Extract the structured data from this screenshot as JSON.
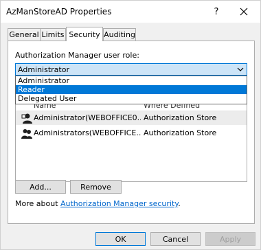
{
  "window": {
    "title": "AzManStoreAD Properties",
    "help_glyph": "?"
  },
  "tabs": [
    {
      "label": "General"
    },
    {
      "label": "Limits"
    },
    {
      "label": "Security",
      "active": true
    },
    {
      "label": "Auditing"
    }
  ],
  "security": {
    "role_label": "Authorization Manager user role:",
    "role_selected": "Administrator",
    "role_options": [
      "Administrator",
      "Reader",
      "Delegated User"
    ],
    "highlighted_option": "Reader",
    "list_columns": {
      "name": "Name",
      "where": "Where Defined"
    },
    "users": [
      {
        "name": "Administrator(WEBOFFICE0...",
        "where": "Authorization Store",
        "icon": "user-icon"
      },
      {
        "name": "Administrators(WEBOFFICE...",
        "where": "Authorization Store",
        "icon": "group-icon"
      }
    ],
    "add_label": "Add...",
    "remove_label": "Remove",
    "more_about_prefix": "More about ",
    "more_about_link": "Authorization Manager security",
    "more_about_suffix": "."
  },
  "footer": {
    "ok_label": "OK",
    "cancel_label": "Cancel",
    "apply_label": "Apply"
  },
  "colors": {
    "accent": "#0078d7",
    "link": "#0066cc",
    "dialog_bg": "#f0f0f0"
  }
}
